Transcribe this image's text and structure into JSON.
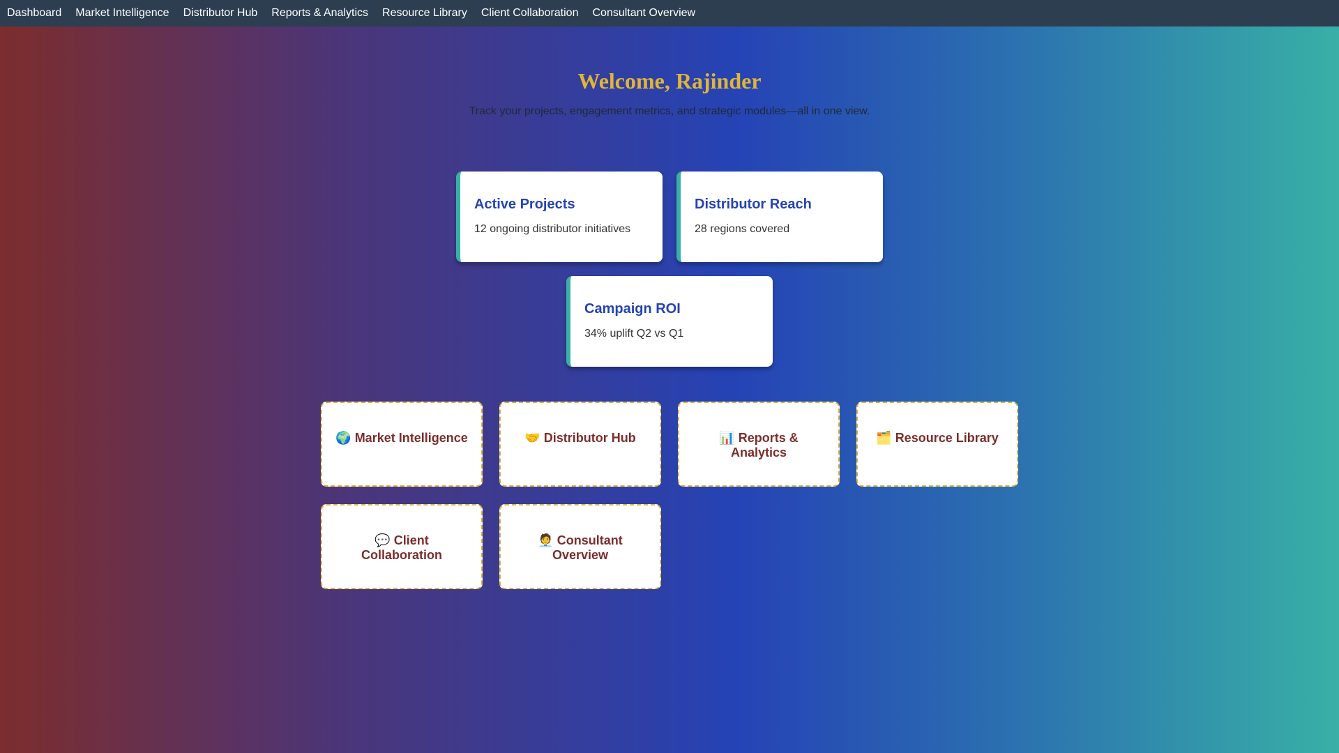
{
  "nav": [
    {
      "label": "Dashboard"
    },
    {
      "label": "Market Intelligence"
    },
    {
      "label": "Distributor Hub"
    },
    {
      "label": "Reports & Analytics"
    },
    {
      "label": "Resource Library"
    },
    {
      "label": "Client Collaboration"
    },
    {
      "label": "Consultant Overview"
    }
  ],
  "header": {
    "welcome": "Welcome, Rajinder",
    "subtitle": "Track your projects, engagement metrics, and strategic modules—all in one view."
  },
  "stats": [
    {
      "title": "Active Projects",
      "desc": "12 ongoing distributor initiatives"
    },
    {
      "title": "Distributor Reach",
      "desc": "28 regions covered"
    },
    {
      "title": "Campaign ROI",
      "desc": "34% uplift Q2 vs Q1"
    }
  ],
  "modules": [
    {
      "icon": "🌍",
      "icon_name": "globe-icon",
      "label": "Market Intelligence"
    },
    {
      "icon": "🤝",
      "icon_name": "handshake-icon",
      "label": "Distributor Hub"
    },
    {
      "icon": "📊",
      "icon_name": "bar-chart-icon",
      "label": "Reports & Analytics"
    },
    {
      "icon": "🗂️",
      "icon_name": "folder-icon",
      "label": "Resource Library"
    },
    {
      "icon": "💬",
      "icon_name": "speech-bubble-icon",
      "label": "Client Collaboration"
    },
    {
      "icon": "🧑‍💼",
      "icon_name": "consultant-icon",
      "label": "Consultant Overview"
    }
  ],
  "colors": {
    "nav_bg": "#2c3e50",
    "accent_gold": "#e0b437",
    "accent_teal": "#38b0a6",
    "title_blue": "#2543b5",
    "module_text": "#7c2d2d"
  }
}
